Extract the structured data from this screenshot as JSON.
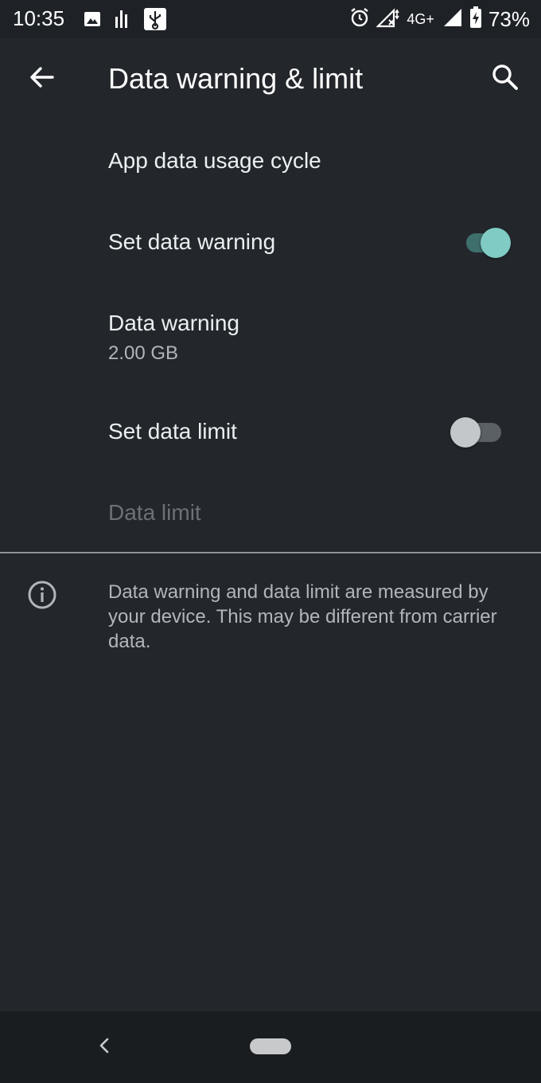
{
  "status_bar": {
    "time": "10:35",
    "network": "4G+",
    "battery": "73%",
    "left_icons": [
      "image-icon",
      "chart-icon",
      "usb-icon"
    ],
    "right_icons": [
      "alarm-icon",
      "no-signal-icon",
      "signal-icon",
      "battery-charging-icon"
    ]
  },
  "app_bar": {
    "title": "Data warning & limit",
    "back_icon": "arrow-back-icon",
    "search_icon": "search-icon"
  },
  "settings": {
    "app_data_usage_cycle": {
      "title": "App data usage cycle"
    },
    "set_data_warning": {
      "title": "Set data warning",
      "enabled": true
    },
    "data_warning": {
      "title": "Data warning",
      "value": "2.00 GB"
    },
    "set_data_limit": {
      "title": "Set data limit",
      "enabled": false
    },
    "data_limit": {
      "title": "Data limit",
      "disabled": true
    }
  },
  "info": {
    "icon": "info-icon",
    "text": "Data warning and data limit are measured by your device. This may be different from carrier data."
  },
  "colors": {
    "background": "#23272c",
    "accent": "#80cbc4"
  },
  "nav_bar": {
    "back_icon": "nav-back-icon",
    "home_icon": "home-pill-icon"
  }
}
